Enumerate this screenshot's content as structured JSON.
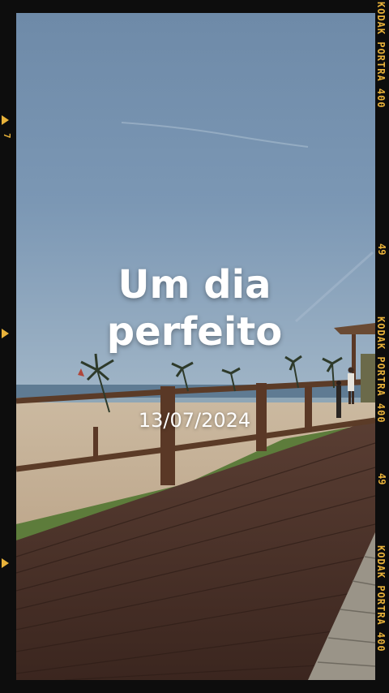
{
  "overlay": {
    "title_line1": "Um dia",
    "title_line2": "perfeito",
    "date": "13/07/2024"
  },
  "film_frame": {
    "brand_label": "KODAK PORTRA 400",
    "frame_numbers": [
      "49",
      "49"
    ],
    "left_marker": "7",
    "accent_color": "#e8b23a"
  }
}
